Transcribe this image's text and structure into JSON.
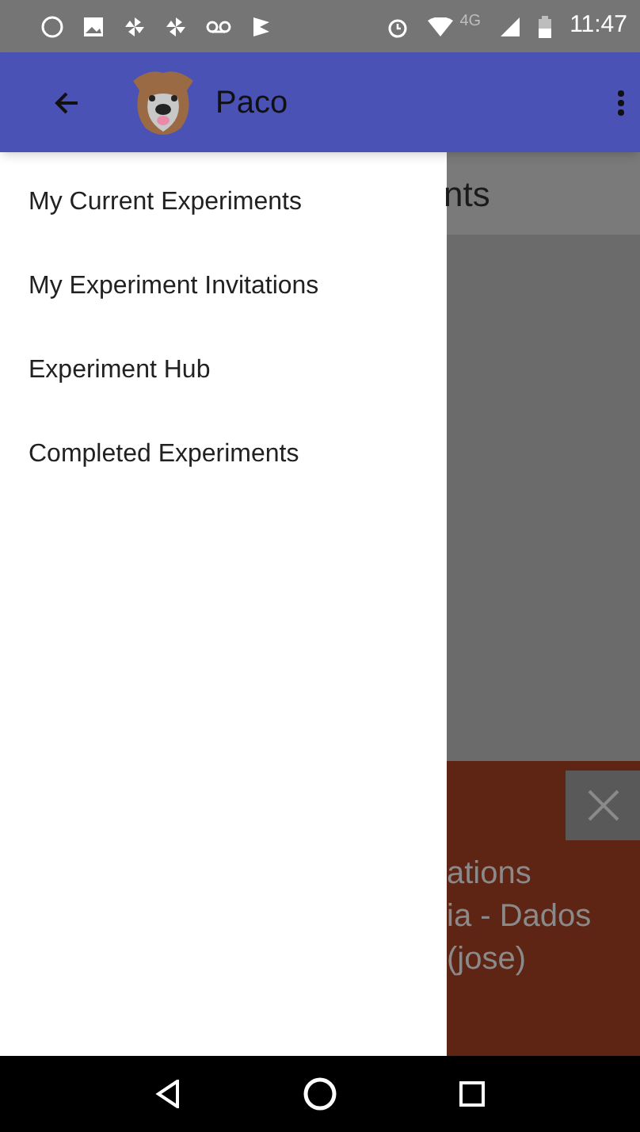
{
  "status_bar": {
    "time": "11:47",
    "network": "4G"
  },
  "app_bar": {
    "title": "Paco"
  },
  "drawer": {
    "items": [
      {
        "label": "My Current Experiments"
      },
      {
        "label": "My Experiment Invitations"
      },
      {
        "label": "Experiment Hub"
      },
      {
        "label": "Completed Experiments"
      }
    ]
  },
  "background": {
    "header": "nts",
    "card_lines": [
      "ations",
      "ia - Dados",
      "(jose)"
    ]
  }
}
